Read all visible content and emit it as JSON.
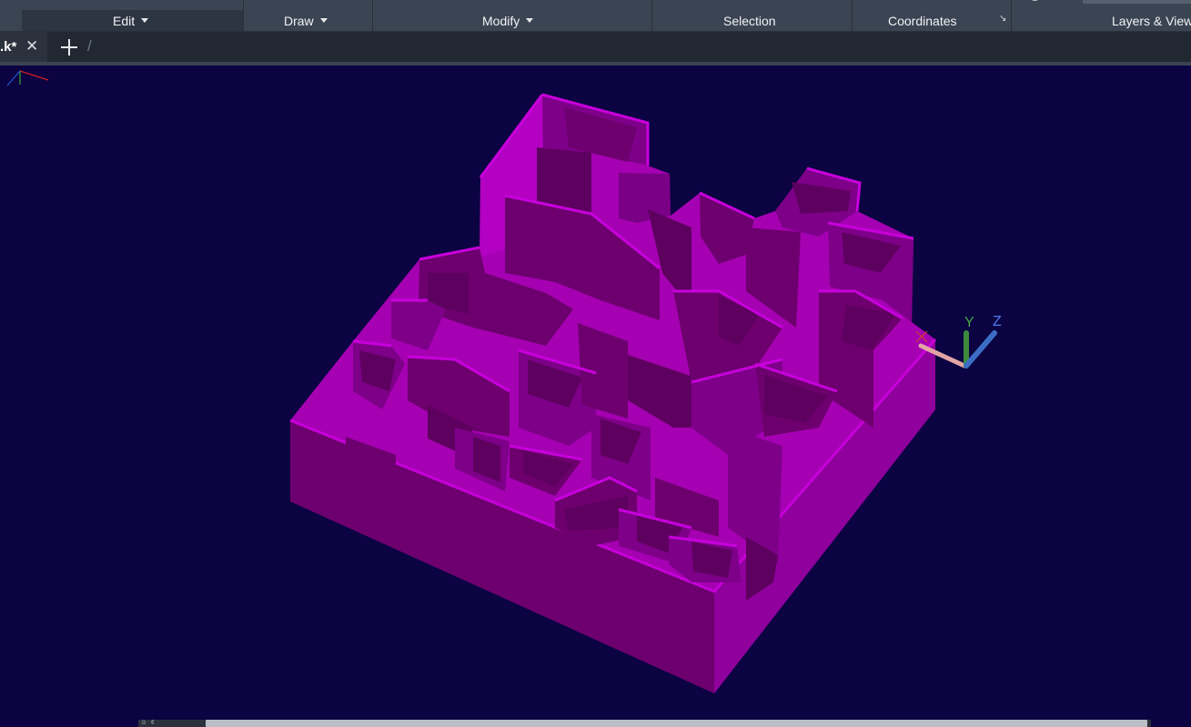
{
  "ribbon": {
    "panels": [
      {
        "label": "Edit",
        "dropdown": true
      },
      {
        "label": "Draw",
        "dropdown": true
      },
      {
        "label": "Modify",
        "dropdown": true
      },
      {
        "label": "Selection",
        "dropdown": false
      },
      {
        "label": "Coordinates",
        "dropdown": false
      },
      {
        "label": "Layers & View",
        "dropdown": false
      }
    ],
    "panel_launcher_icon": "dialog-launcher-arrow"
  },
  "tabs": {
    "active_tab": ".k*",
    "close_glyph": "✕",
    "new_tab_icon": "plus-icon",
    "divider_glyph": "/"
  },
  "viewport": {
    "background_color": "#0b0342",
    "model_color": "#a600b3",
    "model_side_color": "#6d006e",
    "ucs_icon": {
      "x_label": "X",
      "y_label": "Y",
      "z_label": "Z"
    }
  },
  "scrollbar": {
    "left_glyphs": "ü  ¢"
  }
}
